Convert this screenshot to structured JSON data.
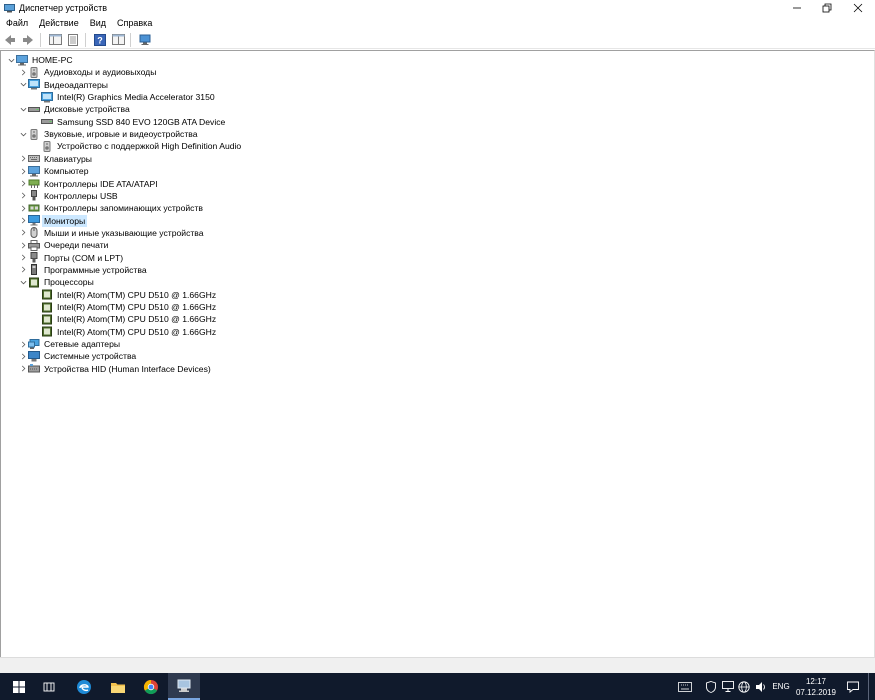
{
  "window": {
    "title": "Диспетчер устройств"
  },
  "menu": {
    "file": "Файл",
    "action": "Действие",
    "view": "Вид",
    "help": "Справка"
  },
  "tree": {
    "root": "HOME-PC",
    "items": [
      {
        "label": "Аудиовходы и аудиовыходы",
        "icon": "speaker-icon",
        "expanded": false
      },
      {
        "label": "Видеоадаптеры",
        "icon": "display-adapter-icon",
        "expanded": true
      },
      {
        "label": "Intel(R) Graphics Media Accelerator 3150",
        "icon": "display-adapter-icon",
        "child": true
      },
      {
        "label": "Дисковые устройства",
        "icon": "disk-icon",
        "expanded": true
      },
      {
        "label": "Samsung SSD 840 EVO 120GB ATA Device",
        "icon": "disk-icon",
        "child": true
      },
      {
        "label": "Звуковые, игровые и видеоустройства",
        "icon": "speaker-icon",
        "expanded": true
      },
      {
        "label": "Устройство с поддержкой High Definition Audio",
        "icon": "speaker-icon",
        "child": true
      },
      {
        "label": "Клавиатуры",
        "icon": "keyboard-icon",
        "expanded": false
      },
      {
        "label": "Компьютер",
        "icon": "computer-icon",
        "expanded": false
      },
      {
        "label": "Контроллеры IDE ATA/ATAPI",
        "icon": "ide-icon",
        "expanded": false
      },
      {
        "label": "Контроллеры USB",
        "icon": "usb-icon",
        "expanded": false
      },
      {
        "label": "Контроллеры запоминающих устройств",
        "icon": "storage-icon",
        "expanded": false
      },
      {
        "label": "Мониторы",
        "icon": "monitor-icon",
        "expanded": false,
        "selected": true
      },
      {
        "label": "Мыши и иные указывающие устройства",
        "icon": "mouse-icon",
        "expanded": false
      },
      {
        "label": "Очереди печати",
        "icon": "printer-icon",
        "expanded": false
      },
      {
        "label": "Порты (COM и LPT)",
        "icon": "port-icon",
        "expanded": false
      },
      {
        "label": "Программные устройства",
        "icon": "software-device-icon",
        "expanded": false
      },
      {
        "label": "Процессоры",
        "icon": "cpu-icon",
        "expanded": true
      },
      {
        "label": "Intel(R) Atom(TM) CPU D510   @ 1.66GHz",
        "icon": "cpu-icon",
        "child": true
      },
      {
        "label": "Intel(R) Atom(TM) CPU D510   @ 1.66GHz",
        "icon": "cpu-icon",
        "child": true
      },
      {
        "label": "Intel(R) Atom(TM) CPU D510   @ 1.66GHz",
        "icon": "cpu-icon",
        "child": true
      },
      {
        "label": "Intel(R) Atom(TM) CPU D510   @ 1.66GHz",
        "icon": "cpu-icon",
        "child": true
      },
      {
        "label": "Сетевые адаптеры",
        "icon": "network-icon",
        "expanded": false
      },
      {
        "label": "Системные устройства",
        "icon": "system-device-icon",
        "expanded": false
      },
      {
        "label": "Устройства HID (Human Interface Devices)",
        "icon": "hid-icon",
        "expanded": false
      }
    ]
  },
  "taskbar": {
    "lang": "ENG",
    "time": "12:17",
    "date": "07.12.2019"
  },
  "colors": {
    "selection": "#cce8ff",
    "taskbar": "#101a2c"
  }
}
